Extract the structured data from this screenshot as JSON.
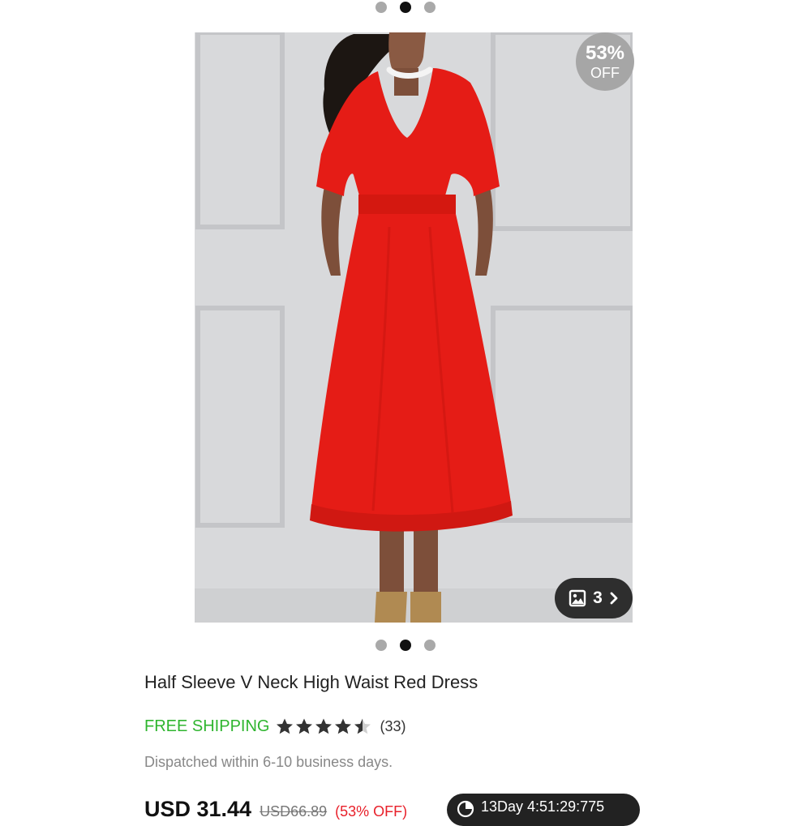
{
  "carousel": {
    "total": 3,
    "active_index": 1
  },
  "product": {
    "discount_pct": "53%",
    "discount_off": "OFF",
    "gallery_count": "3",
    "title": "Half Sleeve V Neck High Waist Red Dress",
    "free_shipping": "FREE SHIPPING",
    "rating": 4.5,
    "rating_max": 5,
    "review_count": "(33)",
    "dispatch": "Dispatched within 6-10 business days.",
    "price_now": "USD 31.44",
    "price_was": "USD66.89",
    "price_off": "(53% OFF)",
    "countdown": "13Day 4:51:29:775"
  },
  "colors": {
    "accent_green": "#2fb52f",
    "discount_red": "#e8202a",
    "dress_red": "#e51c16"
  },
  "icons": {
    "gallery": "image-icon",
    "gallery_next": "chevron-right-icon",
    "rating": "star-icon",
    "countdown": "clock-icon"
  }
}
